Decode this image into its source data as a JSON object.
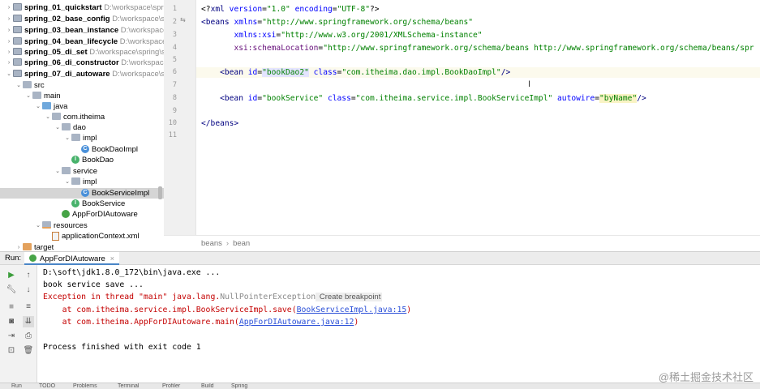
{
  "project_tree": {
    "rows": [
      {
        "name": "spring_01_quickstart",
        "path": "D:\\workspace\\spr",
        "indent": 0,
        "twisty": "›",
        "icon": "module",
        "bold": true
      },
      {
        "name": "spring_02_base_config",
        "path": "D:\\workspace\\sp",
        "indent": 0,
        "twisty": "›",
        "icon": "module",
        "bold": true
      },
      {
        "name": "spring_03_bean_instance",
        "path": "D:\\workspace\\",
        "indent": 0,
        "twisty": "›",
        "icon": "module",
        "bold": true
      },
      {
        "name": "spring_04_bean_lifecycle",
        "path": "D:\\workspace\\sp",
        "indent": 0,
        "twisty": "›",
        "icon": "module",
        "bold": true
      },
      {
        "name": "spring_05_di_set",
        "path": "D:\\workspace\\spring\\s",
        "indent": 0,
        "twisty": "›",
        "icon": "module",
        "bold": true
      },
      {
        "name": "spring_06_di_constructor",
        "path": "D:\\workspace\\s",
        "indent": 0,
        "twisty": "›",
        "icon": "module",
        "bold": true
      },
      {
        "name": "spring_07_di_autoware",
        "path": "D:\\workspace\\sp",
        "indent": 0,
        "twisty": "⌄",
        "icon": "module",
        "bold": true
      },
      {
        "name": "src",
        "path": "",
        "indent": 1,
        "twisty": "⌄",
        "icon": "folder",
        "bold": false
      },
      {
        "name": "main",
        "path": "",
        "indent": 2,
        "twisty": "⌄",
        "icon": "folder",
        "bold": false
      },
      {
        "name": "java",
        "path": "",
        "indent": 3,
        "twisty": "⌄",
        "icon": "folder-blue",
        "bold": false
      },
      {
        "name": "com.itheima",
        "path": "",
        "indent": 4,
        "twisty": "⌄",
        "icon": "folder",
        "bold": false
      },
      {
        "name": "dao",
        "path": "",
        "indent": 5,
        "twisty": "⌄",
        "icon": "folder",
        "bold": false
      },
      {
        "name": "impl",
        "path": "",
        "indent": 6,
        "twisty": "⌄",
        "icon": "folder",
        "bold": false
      },
      {
        "name": "BookDaoImpl",
        "path": "",
        "indent": 7,
        "twisty": "",
        "icon": "cls",
        "bold": false
      },
      {
        "name": "BookDao",
        "path": "",
        "indent": 6,
        "twisty": "",
        "icon": "iface",
        "bold": false
      },
      {
        "name": "service",
        "path": "",
        "indent": 5,
        "twisty": "⌄",
        "icon": "folder",
        "bold": false
      },
      {
        "name": "impl",
        "path": "",
        "indent": 6,
        "twisty": "⌄",
        "icon": "folder",
        "bold": false
      },
      {
        "name": "BookServiceImpl",
        "path": "",
        "indent": 7,
        "twisty": "",
        "icon": "cls",
        "bold": false,
        "selected": true
      },
      {
        "name": "BookService",
        "path": "",
        "indent": 6,
        "twisty": "",
        "icon": "iface",
        "bold": false
      },
      {
        "name": "AppForDIAutoware",
        "path": "",
        "indent": 5,
        "twisty": "",
        "icon": "main-cls",
        "bold": false
      },
      {
        "name": "resources",
        "path": "",
        "indent": 3,
        "twisty": "⌄",
        "icon": "folder-res",
        "bold": false
      },
      {
        "name": "applicationContext.xml",
        "path": "",
        "indent": 4,
        "twisty": "",
        "icon": "xml",
        "bold": false
      },
      {
        "name": "target",
        "path": "",
        "indent": 1,
        "twisty": "›",
        "icon": "folder-target",
        "bold": false
      }
    ]
  },
  "editor": {
    "line_numbers": [
      "1",
      "2",
      "3",
      "4",
      "5",
      "6",
      "7",
      "8",
      "9",
      "10",
      "11"
    ],
    "lines": [
      [
        {
          "t": "<?",
          "c": "pi"
        },
        {
          "t": "xml ",
          "c": "tag"
        },
        {
          "t": "version",
          "c": "attr"
        },
        {
          "t": "=",
          "c": "pi"
        },
        {
          "t": "\"1.0\"",
          "c": "val"
        },
        {
          "t": " ",
          "c": "pi"
        },
        {
          "t": "encoding",
          "c": "attr"
        },
        {
          "t": "=",
          "c": "pi"
        },
        {
          "t": "\"UTF-8\"",
          "c": "val"
        },
        {
          "t": "?>",
          "c": "pi"
        }
      ],
      [
        {
          "t": "<beans ",
          "c": "tag"
        },
        {
          "t": "xmlns",
          "c": "attr"
        },
        {
          "t": "=",
          "c": "pi"
        },
        {
          "t": "\"http://www.springframework.org/schema/beans\"",
          "c": "val"
        }
      ],
      [
        {
          "t": "       ",
          "c": "pi"
        },
        {
          "t": "xmlns:xsi",
          "c": "attr"
        },
        {
          "t": "=",
          "c": "pi"
        },
        {
          "t": "\"http://www.w3.org/2001/XMLSchema-instance\"",
          "c": "val"
        }
      ],
      [
        {
          "t": "       ",
          "c": "pi"
        },
        {
          "t": "xsi:schemaLocation",
          "c": "ns"
        },
        {
          "t": "=",
          "c": "pi"
        },
        {
          "t": "\"http://www.springframework.org/schema/beans http://www.springframework.org/schema/beans/spr",
          "c": "val"
        }
      ],
      [],
      [
        {
          "t": "    ",
          "c": "pi"
        },
        {
          "t": "<bean ",
          "c": "tag"
        },
        {
          "t": "id",
          "c": "attr"
        },
        {
          "t": "=",
          "c": "pi"
        },
        {
          "t": "\"bookDao2\"",
          "c": "val hi"
        },
        {
          "t": " ",
          "c": "pi"
        },
        {
          "t": "class",
          "c": "attr"
        },
        {
          "t": "=",
          "c": "pi"
        },
        {
          "t": "\"com.itheima.dao.impl.BookDaoImpl\"",
          "c": "val"
        },
        {
          "t": "/>",
          "c": "tag"
        }
      ],
      [],
      [
        {
          "t": "    ",
          "c": "pi"
        },
        {
          "t": "<bean ",
          "c": "tag"
        },
        {
          "t": "id",
          "c": "attr"
        },
        {
          "t": "=",
          "c": "pi"
        },
        {
          "t": "\"bookService\"",
          "c": "val"
        },
        {
          "t": " ",
          "c": "pi"
        },
        {
          "t": "class",
          "c": "attr"
        },
        {
          "t": "=",
          "c": "pi"
        },
        {
          "t": "\"com.itheima.service.impl.BookServiceImpl\"",
          "c": "val"
        },
        {
          "t": " ",
          "c": "pi"
        },
        {
          "t": "autowire",
          "c": "attr"
        },
        {
          "t": "=",
          "c": "pi"
        },
        {
          "t": "\"byName\"",
          "c": "val hi-y"
        },
        {
          "t": "/>",
          "c": "tag"
        }
      ],
      [],
      [
        {
          "t": "</beans>",
          "c": "tag"
        }
      ],
      []
    ],
    "breadcrumb": [
      "beans",
      "bean"
    ]
  },
  "run_panel": {
    "label": "Run:",
    "tab_label": "AppForDIAutoware",
    "console_lines": [
      [
        {
          "t": "D:\\soft\\jdk1.8.0_172\\bin\\java.exe ...",
          "c": ""
        }
      ],
      [
        {
          "t": "book service save ...",
          "c": ""
        }
      ],
      [
        {
          "t": "Exception in thread \"main\" java.lang.",
          "c": "con-red"
        },
        {
          "t": "NullPointerException",
          "c": "con-grey"
        },
        {
          "t": " Create breakpoint",
          "c": "bp-hint"
        }
      ],
      [
        {
          "t": "    at com.itheima.service.impl.BookServiceImpl.save(",
          "c": "con-red"
        },
        {
          "t": "BookServiceImpl.java:15",
          "c": "con-link"
        },
        {
          "t": ")",
          "c": "con-red"
        }
      ],
      [
        {
          "t": "    at com.itheima.AppForDIAutoware.main(",
          "c": "con-red"
        },
        {
          "t": "AppForDIAutoware.java:12",
          "c": "con-link"
        },
        {
          "t": ")",
          "c": "con-red"
        }
      ],
      [],
      [
        {
          "t": "Process finished with exit code 1",
          "c": ""
        }
      ]
    ]
  },
  "bottom_bar": {
    "items": [
      "Run",
      "TODO",
      "Problems",
      "Terminal",
      "Profiler",
      "Build",
      "Spring"
    ]
  },
  "watermark": "@稀土掘金技术社区"
}
